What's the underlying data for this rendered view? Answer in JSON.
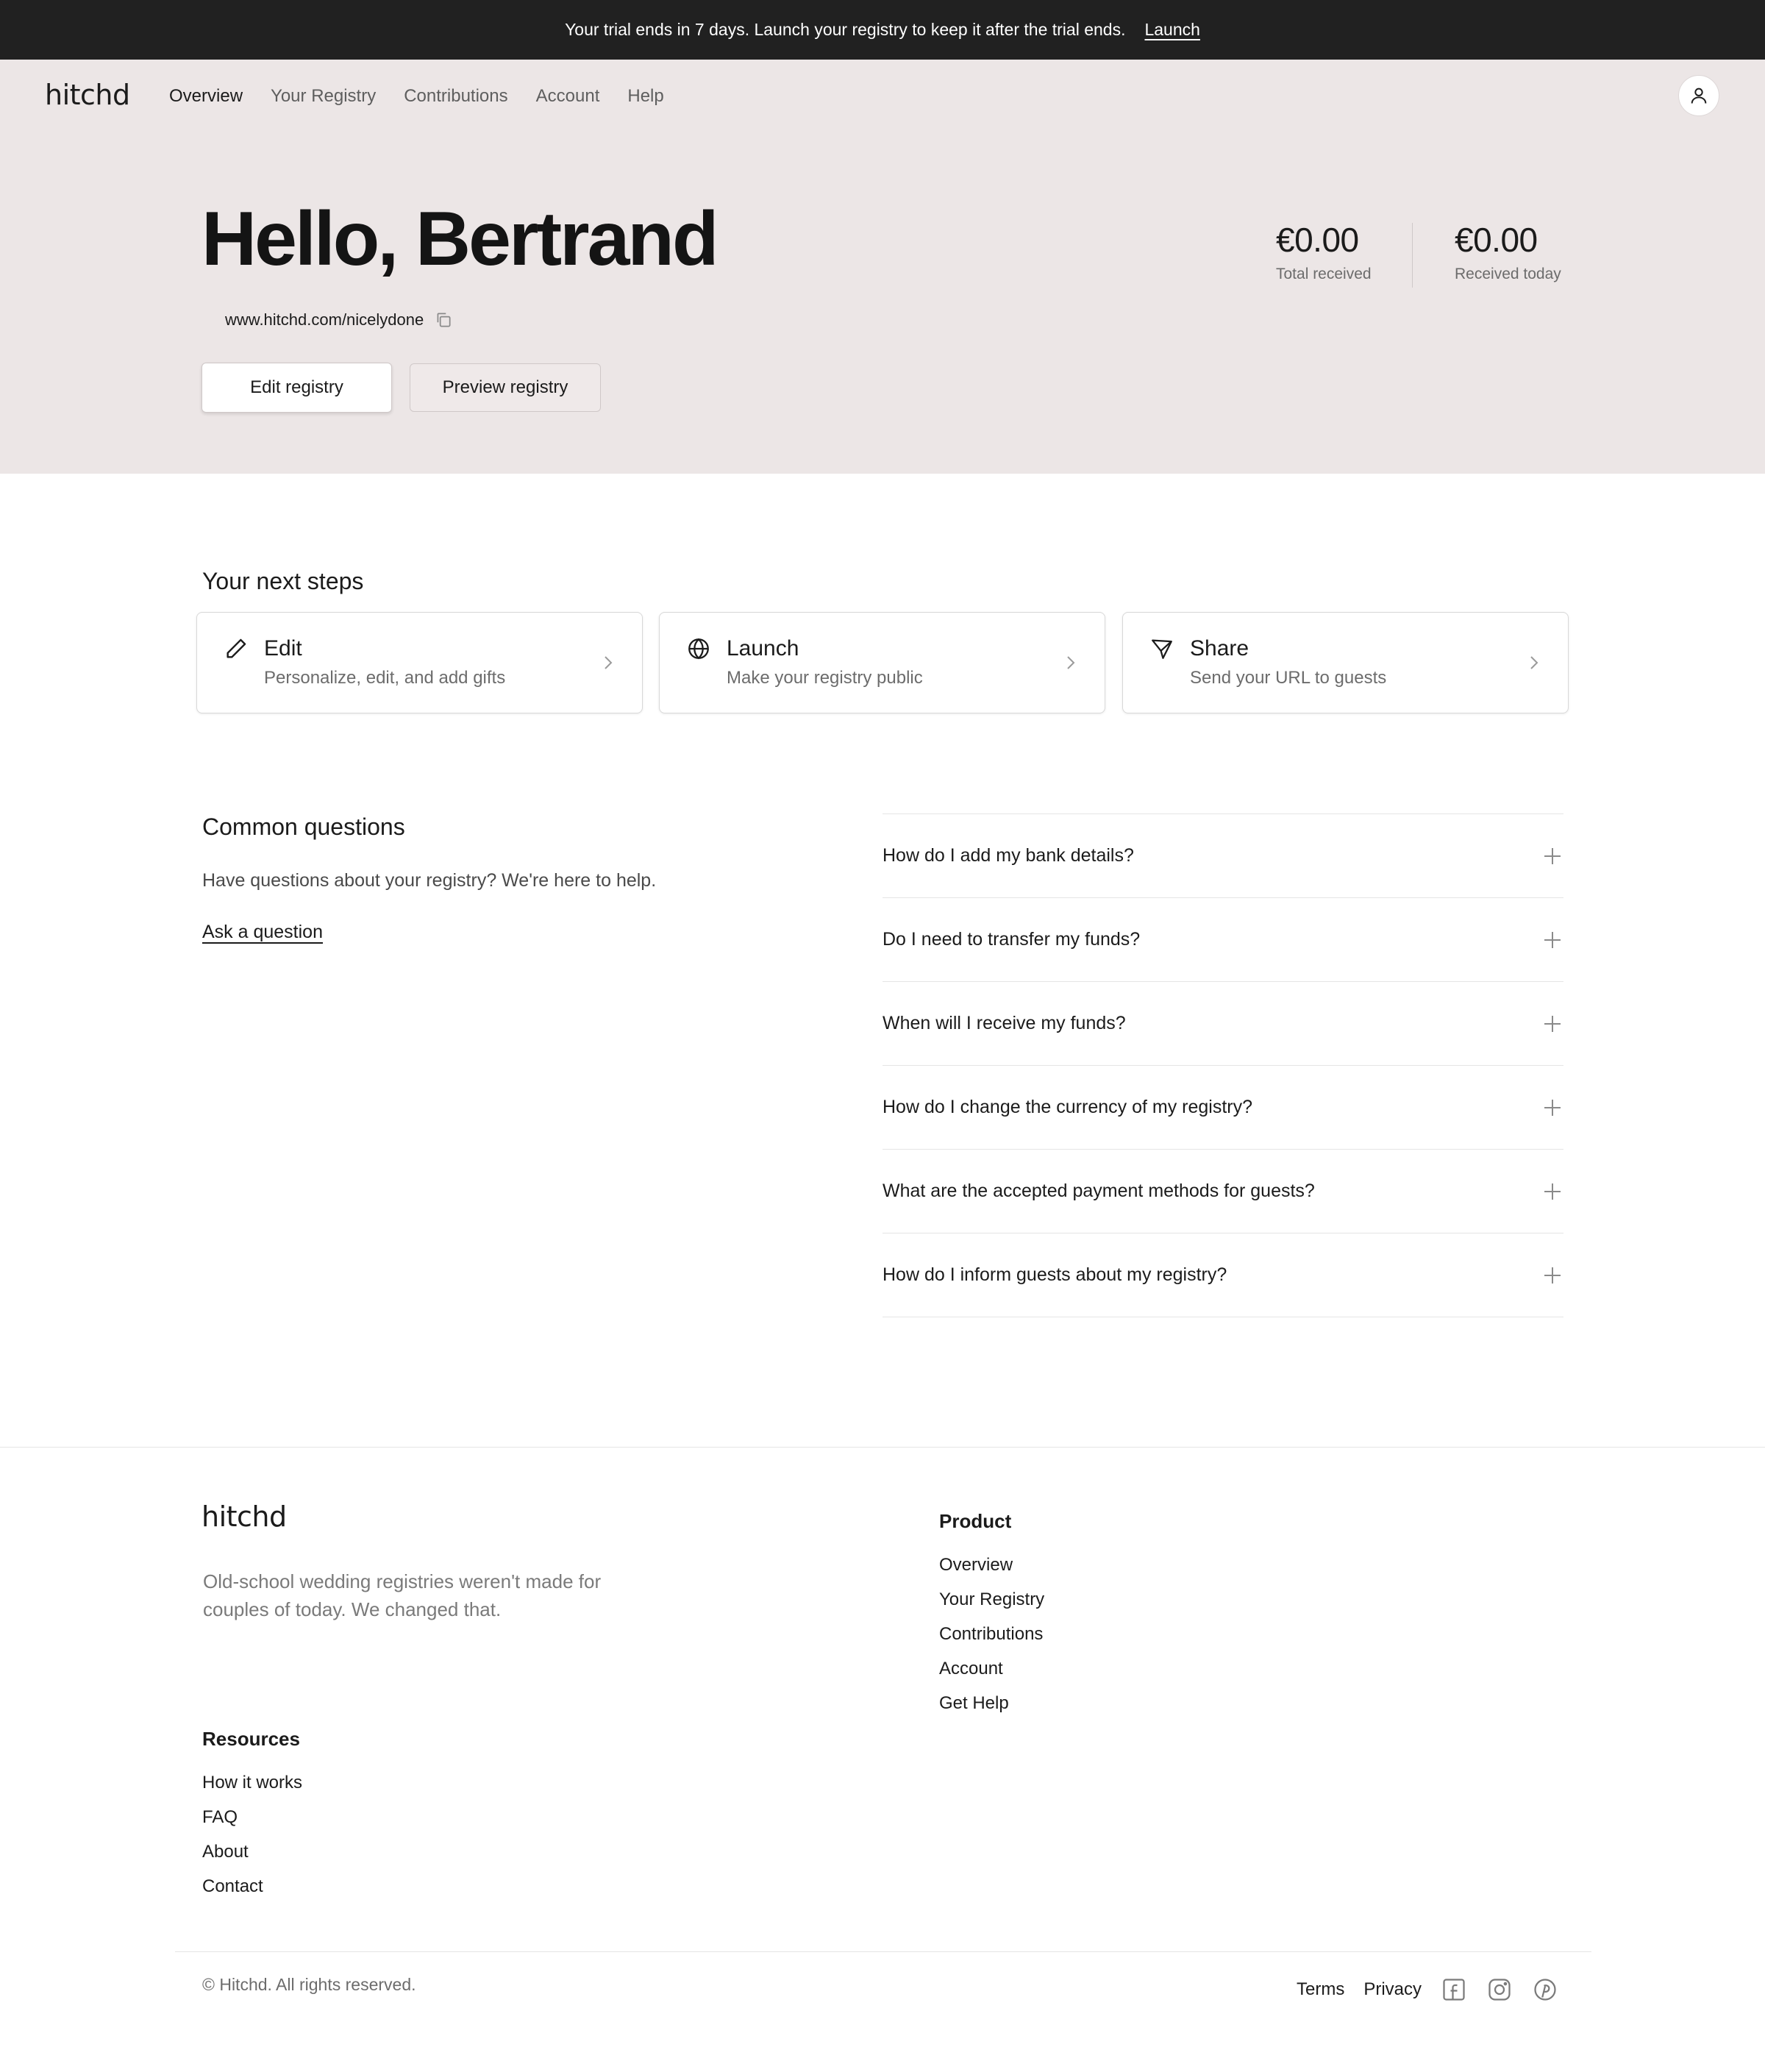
{
  "banner": {
    "message": "Your trial ends in 7 days. Launch your registry to keep it after the trial ends.",
    "link": "Launch"
  },
  "header": {
    "logo": "hitchd",
    "nav": [
      "Overview",
      "Your Registry",
      "Contributions",
      "Account",
      "Help"
    ],
    "active_nav": "Overview",
    "avatar_icon": "user-icon"
  },
  "hero": {
    "greeting": "Hello, Bertrand",
    "registry_url": "www.hitchd.com/nicelydone",
    "copy_icon": "copy-icon",
    "edit_button": "Edit registry",
    "preview_button": "Preview registry",
    "stats": [
      {
        "value": "€0.00",
        "label": "Total received"
      },
      {
        "value": "€0.00",
        "label": "Received today"
      }
    ]
  },
  "next_steps": {
    "title": "Your next steps",
    "cards": [
      {
        "icon": "pencil-icon",
        "title": "Edit",
        "subtitle": "Personalize, edit, and add gifts"
      },
      {
        "icon": "globe-icon",
        "title": "Launch",
        "subtitle": "Make your registry public"
      },
      {
        "icon": "send-icon",
        "title": "Share",
        "subtitle": "Send your URL to guests"
      }
    ]
  },
  "questions": {
    "title": "Common questions",
    "text": "Have questions about your registry? We're here to help.",
    "ask_link": "Ask a question",
    "faqs": [
      "How do I add my bank details?",
      "Do I need to transfer my funds?",
      "When will I receive my funds?",
      "How do I change the currency of my registry?",
      "What are the accepted payment methods for guests?",
      "How do I inform guests about my registry?"
    ]
  },
  "footer": {
    "logo": "hitchd",
    "tagline": "Old-school wedding registries weren't made for couples of today. We changed that.",
    "product": {
      "title": "Product",
      "links": [
        "Overview",
        "Your Registry",
        "Contributions",
        "Account",
        "Get Help"
      ]
    },
    "resources": {
      "title": "Resources",
      "links": [
        "How it works",
        "FAQ",
        "About",
        "Contact"
      ]
    },
    "copyright": "© Hitchd. All rights reserved.",
    "legal": [
      "Terms",
      "Privacy"
    ],
    "social_icons": [
      "facebook-icon",
      "instagram-icon",
      "pinterest-icon"
    ]
  }
}
